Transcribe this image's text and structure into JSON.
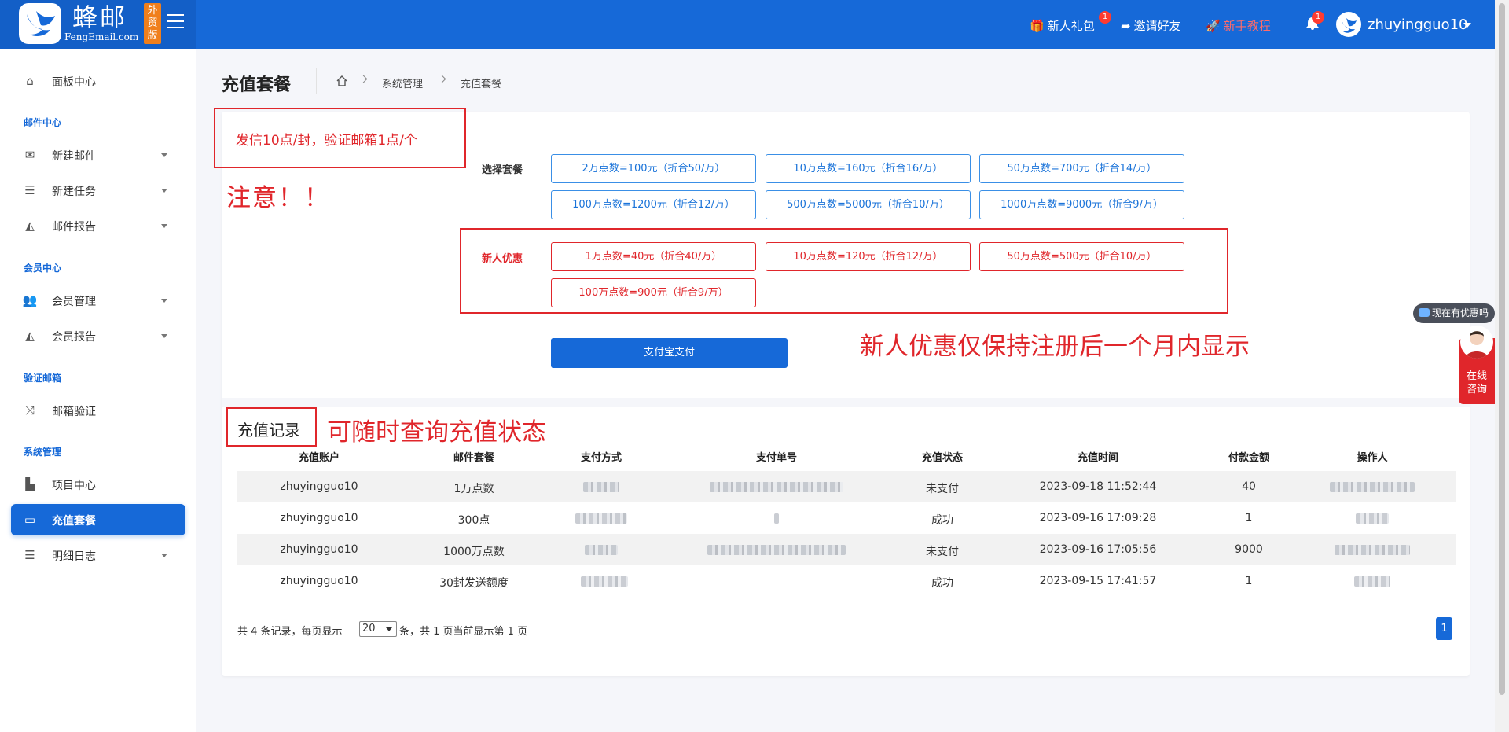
{
  "header": {
    "brand_title": "蜂邮",
    "brand_sub": "FengEmail.com",
    "brand_badge": "外贸版",
    "links": [
      {
        "label": "新人礼包",
        "badge": "1"
      },
      {
        "label": "邀请好友"
      },
      {
        "label": "新手教程"
      }
    ],
    "notification_count": "1",
    "username": "zhuyingguo10"
  },
  "sidebar": {
    "items": [
      {
        "label": "面板中心"
      },
      {
        "group": "邮件中心"
      },
      {
        "label": "新建邮件"
      },
      {
        "label": "新建任务"
      },
      {
        "label": "邮件报告"
      },
      {
        "group": "会员中心"
      },
      {
        "label": "会员管理"
      },
      {
        "label": "会员报告"
      },
      {
        "group": "验证邮箱"
      },
      {
        "label": "邮箱验证"
      },
      {
        "group": "系统管理"
      },
      {
        "label": "项目中心"
      },
      {
        "label": "充值套餐"
      },
      {
        "label": "明细日志"
      }
    ]
  },
  "page": {
    "title": "充值套餐",
    "breadcrumb": [
      "系统管理",
      "充值套餐"
    ]
  },
  "annotations": {
    "note": "发信10点/封，验证邮箱1点/个",
    "attention": "注意！！",
    "promo_note": "新人优惠仅保持注册后一个月内显示",
    "record_note": "可随时查询充值状态"
  },
  "packages": {
    "label": "选择套餐",
    "options": [
      "2万点数=100元（折合50/万）",
      "10万点数=160元（折合16/万）",
      "50万点数=700元（折合14/万）",
      "100万点数=1200元（折合12/万）",
      "500万点数=5000元（折合10/万）",
      "1000万点数=9000元（折合9/万）"
    ]
  },
  "promo": {
    "label": "新人优惠",
    "options": [
      "1万点数=40元（折合40/万）",
      "10万点数=120元（折合12/万）",
      "50万点数=500元（折合10/万）",
      "100万点数=900元（折合9/万）"
    ]
  },
  "pay_button": "支付宝支付",
  "records": {
    "title": "充值记录",
    "columns": [
      "充值账户",
      "邮件套餐",
      "支付方式",
      "支付单号",
      "充值状态",
      "充值时间",
      "付款金额",
      "操作人"
    ],
    "rows": [
      {
        "account": "zhuyingguo10",
        "package": "1万点数",
        "status": "未支付",
        "time": "2023-09-18 11:52:44",
        "amount": "40"
      },
      {
        "account": "zhuyingguo10",
        "package": "300点",
        "status": "成功",
        "time": "2023-09-16 17:09:28",
        "amount": "1"
      },
      {
        "account": "zhuyingguo10",
        "package": "1000万点数",
        "status": "未支付",
        "time": "2023-09-16 17:05:56",
        "amount": "9000"
      },
      {
        "account": "zhuyingguo10",
        "package": "30封发送额度",
        "status": "成功",
        "time": "2023-09-15 17:41:57",
        "amount": "1"
      }
    ]
  },
  "pager": {
    "prefix": "共 4 条记录，每页显示",
    "page_size": "20",
    "suffix": "条，共 1 页当前显示第 1 页",
    "current": "1"
  },
  "widgets": {
    "promo_chip": "现在有优惠吗",
    "consult": "在线咨询"
  }
}
